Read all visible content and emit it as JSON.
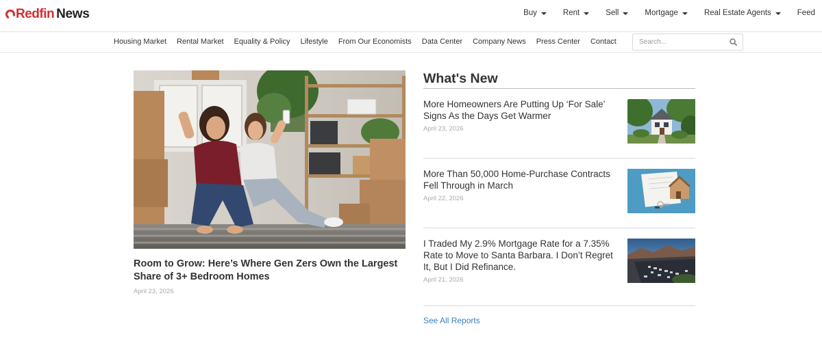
{
  "brand": {
    "name_red": "Redfin",
    "name_dark": "News"
  },
  "main_nav": [
    {
      "label": "Buy",
      "dropdown": true
    },
    {
      "label": "Rent",
      "dropdown": true
    },
    {
      "label": "Sell",
      "dropdown": true
    },
    {
      "label": "Mortgage",
      "dropdown": true
    },
    {
      "label": "Real Estate Agents",
      "dropdown": true
    },
    {
      "label": "Feed",
      "dropdown": false
    }
  ],
  "sub_nav": [
    "Housing Market",
    "Rental Market",
    "Equality & Policy",
    "Lifestyle",
    "From Our Economists",
    "Data Center",
    "Company News",
    "Press Center",
    "Contact"
  ],
  "search": {
    "placeholder": "Search..."
  },
  "featured": {
    "title": "Room to Grow: Here’s Where Gen Zers Own the Largest Share of 3+ Bedroom Homes",
    "date": "April 23, 2026"
  },
  "whats_new": {
    "heading": "What's New",
    "stories": [
      {
        "title": "More Homeowners Are Putting Up ‘For Sale’ Signs As the Days Get Warmer",
        "date": "April 23, 2026"
      },
      {
        "title": "More Than 50,000 Home-Purchase Contracts Fell Through in March",
        "date": "April 22, 2026"
      },
      {
        "title": "I Traded My 2.9% Mortgage Rate for a 7.35% Rate to Move to Santa Barbara. I Don’t Regret It, But I Did Refinance.",
        "date": "April 21, 2026"
      }
    ],
    "see_all": "See All Reports"
  },
  "colors": {
    "brand_red": "#d42c2e",
    "link_blue": "#3a7fb8",
    "date_gray": "#aaaaaa",
    "text": "#333333"
  }
}
